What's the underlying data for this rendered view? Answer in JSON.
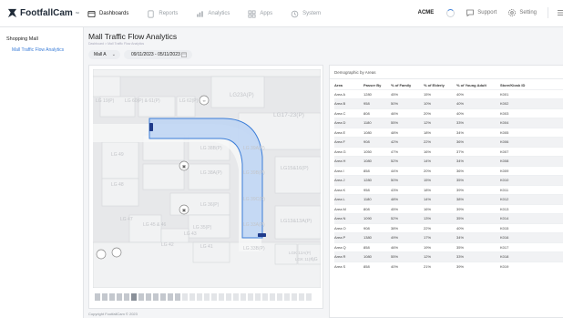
{
  "brand": {
    "name": "FootfallCam",
    "tm": "™"
  },
  "nav": [
    {
      "label": "Dashboards",
      "icon": "dashboard-icon"
    },
    {
      "label": "Reports",
      "icon": "document-icon"
    },
    {
      "label": "Analytics",
      "icon": "chart-icon"
    },
    {
      "label": "Apps",
      "icon": "grid-icon"
    },
    {
      "label": "System",
      "icon": "clock-icon"
    }
  ],
  "header_right": {
    "org": "ACME",
    "support": "Support",
    "setting": "Setting"
  },
  "sidebar": {
    "title": "Shopping Mall",
    "link": "Mall Traffic Flow Analytics"
  },
  "page": {
    "title": "Mall Traffic Flow Analytics",
    "breadcrumb": "Dashboard > Mall Traffic Flow Analytics",
    "site_select": "Mall A",
    "date_range": "09/11/2023 - 05/11/2023"
  },
  "map": {
    "labels": [
      "LG 19(P)",
      "LG 60(P) & 61(P)",
      "LG 62(P)",
      "LG23A(P)",
      "LG17-23(P)",
      "LG 49",
      "LG 38B(P)",
      "LG 39A(P)",
      "LG 48",
      "LG 38A(P)",
      "LG 39B(P)",
      "LG15&16(P)",
      "LG 36(P)",
      "LG 39C(P)",
      "LG 47",
      "LG 45 & 46",
      "LG 35(P)",
      "LG 33A(P)",
      "LG13&13A(P)",
      "LG 43",
      "LG 42",
      "LG 41",
      "LG 33B(P)",
      "LGK 12A(P)",
      "LGK 11(P)",
      "LG"
    ],
    "zoom_thumbs": 30
  },
  "table": {
    "title": "Demographic by Areas",
    "columns": [
      "Area",
      "Passer By",
      "% of Family",
      "% of Elderly",
      "% of Young Adult",
      "Store/Kiosk ID"
    ],
    "rows": [
      [
        "Area A",
        "1280",
        "45%",
        "15%",
        "40%",
        "K001"
      ],
      [
        "Area B",
        "958",
        "50%",
        "10%",
        "40%",
        "K002"
      ],
      [
        "Area C",
        "808",
        "46%",
        "20%",
        "40%",
        "K003"
      ],
      [
        "Area D",
        "1180",
        "55%",
        "12%",
        "33%",
        "K004"
      ],
      [
        "Area E",
        "1080",
        "48%",
        "18%",
        "34%",
        "K005"
      ],
      [
        "Area F",
        "908",
        "42%",
        "22%",
        "36%",
        "K006"
      ],
      [
        "Area G",
        "1050",
        "47%",
        "16%",
        "37%",
        "K007"
      ],
      [
        "Area H",
        "1080",
        "52%",
        "14%",
        "34%",
        "K008"
      ],
      [
        "Area I",
        "858",
        "44%",
        "20%",
        "36%",
        "K009"
      ],
      [
        "Area J",
        "1280",
        "50%",
        "15%",
        "35%",
        "K010"
      ],
      [
        "Area K",
        "958",
        "43%",
        "18%",
        "39%",
        "K011"
      ],
      [
        "Area L",
        "1180",
        "48%",
        "14%",
        "38%",
        "K012"
      ],
      [
        "Area M",
        "808",
        "45%",
        "16%",
        "39%",
        "K013"
      ],
      [
        "Area N",
        "1090",
        "52%",
        "13%",
        "35%",
        "K014"
      ],
      [
        "Area O",
        "908",
        "38%",
        "22%",
        "40%",
        "K015"
      ],
      [
        "Area P",
        "1380",
        "49%",
        "17%",
        "34%",
        "K016"
      ],
      [
        "Area Q",
        "858",
        "46%",
        "19%",
        "35%",
        "K017"
      ],
      [
        "Area R",
        "1080",
        "55%",
        "12%",
        "33%",
        "K018"
      ],
      [
        "Area S",
        "858",
        "40%",
        "21%",
        "39%",
        "K019"
      ]
    ]
  },
  "footer": "Copyright FootfallCam © 2023",
  "colors": {
    "accent": "#3b7dd8",
    "zone_fill": "#bcd3f3",
    "zone_stroke": "#3b7dd8",
    "map_bg": "#e7e8ea"
  }
}
